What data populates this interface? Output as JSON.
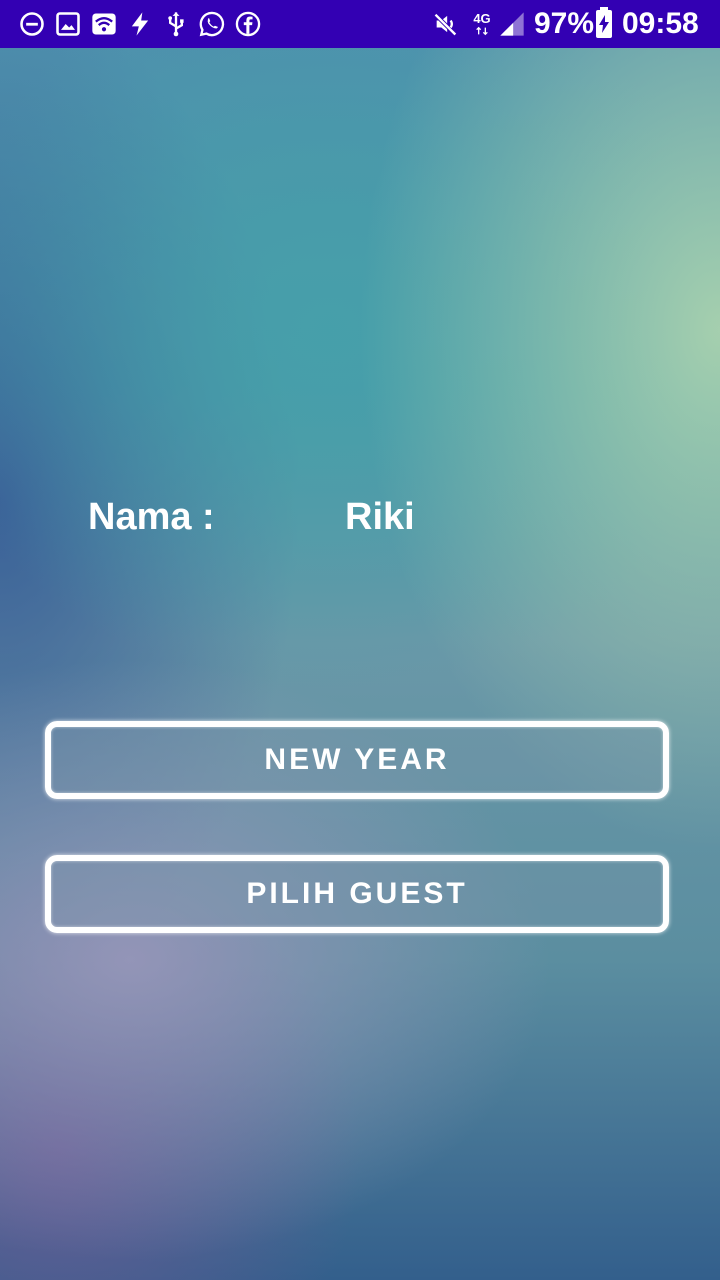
{
  "status_bar": {
    "network": "4G",
    "battery": "97%",
    "time": "09:58",
    "icons_left": [
      "do-not-disturb-icon",
      "image-icon",
      "wifi-icon",
      "flash-icon",
      "usb-icon",
      "whatsapp-icon",
      "facebook-icon"
    ],
    "icons_right": [
      "mute-icon",
      "network-4g-icon",
      "signal-icon",
      "battery-charging-icon"
    ],
    "background": "#3300b3"
  },
  "profile": {
    "name_label": "Nama :",
    "name_value": "Riki"
  },
  "buttons": {
    "new_year": "NEW YEAR",
    "pilih_guest": "PILIH GUEST"
  }
}
